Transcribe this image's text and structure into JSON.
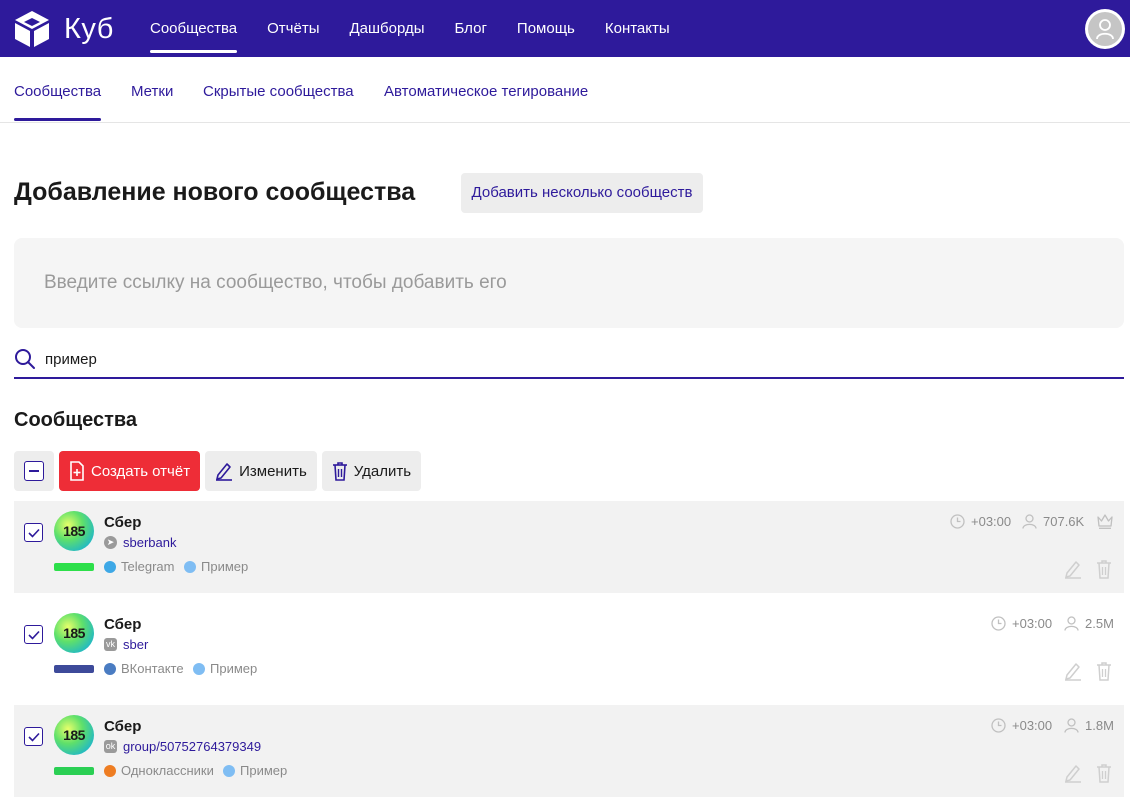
{
  "brand": {
    "name": "Куб"
  },
  "topnav": {
    "items": [
      {
        "label": "Сообщества",
        "active": true
      },
      {
        "label": "Отчёты"
      },
      {
        "label": "Дашборды"
      },
      {
        "label": "Блог"
      },
      {
        "label": "Помощь"
      },
      {
        "label": "Контакты"
      }
    ]
  },
  "subnav": {
    "items": [
      {
        "label": "Сообщества",
        "active": true
      },
      {
        "label": "Метки"
      },
      {
        "label": "Скрытые сообщества"
      },
      {
        "label": "Автоматическое тегирование"
      }
    ]
  },
  "page": {
    "title": "Добавление нового сообщества",
    "multi_button": "Добавить несколько сообществ",
    "url_placeholder": "Введите ссылку на сообщество, чтобы добавить его"
  },
  "search": {
    "value": "пример"
  },
  "communities": {
    "title": "Сообщества",
    "toolbar": {
      "create_report": "Создать отчёт",
      "edit": "Изменить",
      "delete": "Удалить"
    },
    "rows": [
      {
        "name": "Сбер",
        "avatar_text": "185",
        "link": "sberbank",
        "network": "Telegram",
        "network_icon": "telegram-icon",
        "tag": "Пример",
        "timezone": "+03:00",
        "followers": "707.6K",
        "bar_color": "#2ddf4a",
        "network_color": "#3ea8e6",
        "tag_color": "#7fbdf3"
      },
      {
        "name": "Сбер",
        "avatar_text": "185",
        "link": "sber",
        "network": "ВКонтакте",
        "network_icon": "vk-icon",
        "tag": "Пример",
        "timezone": "+03:00",
        "followers": "2.5M",
        "bar_color": "#3d4a9a",
        "network_color": "#4a7cc2",
        "tag_color": "#7fbdf3"
      },
      {
        "name": "Сбер",
        "avatar_text": "185",
        "link": "group/50752764379349",
        "network": "Одноклассники",
        "network_icon": "odnoklassniki-icon",
        "tag": "Пример",
        "timezone": "+03:00",
        "followers": "1.8M",
        "bar_color": "#2bcf54",
        "network_color": "#ee7d22",
        "tag_color": "#7fbdf3"
      }
    ]
  },
  "colors": {
    "primary": "#2e1a9b",
    "danger": "#ee2d37"
  }
}
